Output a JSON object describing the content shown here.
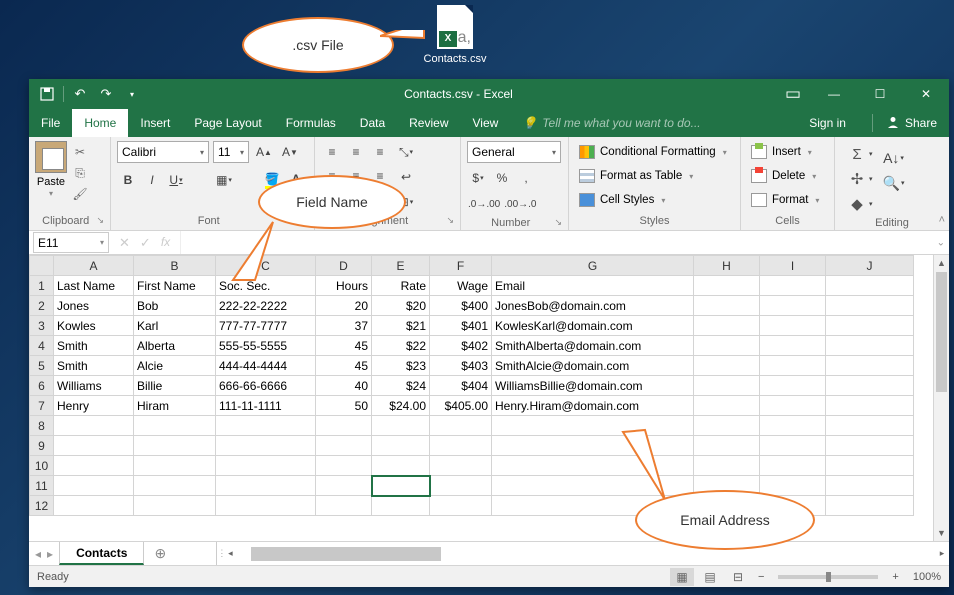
{
  "desktop": {
    "filename": "Contacts.csv",
    "file_x": "X",
    "file_a": "a,"
  },
  "callouts": {
    "c1": ".csv File",
    "c2": "Field Name",
    "c3": "Email Address"
  },
  "titlebar": {
    "title": "Contacts.csv - Excel"
  },
  "menus": {
    "file": "File",
    "home": "Home",
    "insert": "Insert",
    "pagelayout": "Page Layout",
    "formulas": "Formulas",
    "data": "Data",
    "review": "Review",
    "view": "View",
    "tellme": "Tell me what you want to do...",
    "signin": "Sign in",
    "share": "Share"
  },
  "ribbon": {
    "paste": "Paste",
    "font_name": "Calibri",
    "font_size": "11",
    "number_format": "General",
    "cond_fmt": "Conditional Formatting",
    "fmt_table": "Format as Table",
    "cell_styles": "Cell Styles",
    "insert_c": "Insert",
    "delete_c": "Delete",
    "format_c": "Format",
    "groups": {
      "clipboard": "Clipboard",
      "font": "Font",
      "alignment": "Alignment",
      "number": "Number",
      "styles": "Styles",
      "cells": "Cells",
      "editing": "Editing"
    }
  },
  "namebox": "E11",
  "columns": [
    "A",
    "B",
    "C",
    "D",
    "E",
    "F",
    "G",
    "H",
    "I",
    "J"
  ],
  "headers": {
    "A": "Last Name",
    "B": "First Name",
    "C": "Soc. Sec.",
    "D": "Hours",
    "E": "Rate",
    "F": "Wage",
    "G": "Email"
  },
  "chart_data": {
    "type": "table",
    "title": "Contacts.csv",
    "columns": [
      "Last Name",
      "First Name",
      "Soc. Sec.",
      "Hours",
      "Rate",
      "Wage",
      "Email"
    ],
    "rows": [
      [
        "Jones",
        "Bob",
        "222-22-2222",
        20,
        "$20",
        "$400",
        "JonesBob@domain.com"
      ],
      [
        "Kowles",
        "Karl",
        "777-77-7777",
        37,
        "$21",
        "$401",
        "KowlesKarl@domain.com"
      ],
      [
        "Smith",
        "Alberta",
        "555-55-5555",
        45,
        "$22",
        "$402",
        "SmithAlberta@domain.com"
      ],
      [
        "Smith",
        "Alcie",
        "444-44-4444",
        45,
        "$23",
        "$403",
        "SmithAlcie@domain.com"
      ],
      [
        "Williams",
        "Billie",
        "666-66-6666",
        40,
        "$24",
        "$404",
        "WilliamsBillie@domain.com"
      ],
      [
        "Henry",
        "Hiram",
        "111-11-1111",
        50,
        "$24.00",
        "$405.00",
        "Henry.Hiram@domain.com"
      ]
    ]
  },
  "sheet": {
    "tab": "Contacts"
  },
  "status": {
    "ready": "Ready",
    "zoom": "100%"
  }
}
